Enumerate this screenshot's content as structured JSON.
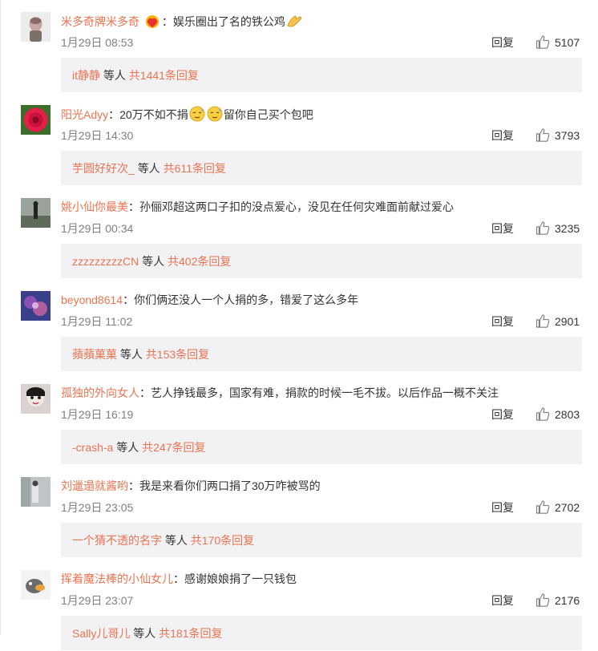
{
  "reply_label": "回复",
  "connector": "等人",
  "comments": [
    {
      "user": "米多奇牌米多奇",
      "text": "娱乐圈出了名的铁公鸡",
      "time": "1月29日 08:53",
      "likes": "5107",
      "reply_user": "it静静",
      "reply_total": "共1441条回复"
    },
    {
      "user": "阳光Adyy",
      "text_a": "20万不如不捐",
      "text_b": "留你自己买个包吧",
      "time": "1月29日 14:30",
      "likes": "3793",
      "reply_user": "芋圆好好次_",
      "reply_total": "共611条回复"
    },
    {
      "user": "姚小仙你最美",
      "text": "孙俪邓超这两口子扣的没点爱心，没见在任何灾难面前献过爱心",
      "time": "1月29日 00:34",
      "likes": "3235",
      "reply_user": "zzzzzzzzzCN",
      "reply_total": "共402条回复"
    },
    {
      "user": "beyond8614",
      "text": "你们俩还没人一个人捐的多，错爱了这么多年",
      "time": "1月29日 11:02",
      "likes": "2901",
      "reply_user": "蘋蘋菓菓",
      "reply_total": "共153条回复"
    },
    {
      "user": "孤独的外向女人",
      "text": "艺人挣钱最多，国家有难，捐款的时候一毛不拔。以后作品一概不关注",
      "time": "1月29日 16:19",
      "likes": "2803",
      "reply_user": "-crash-a",
      "reply_total": "共247条回复"
    },
    {
      "user": "刘邋遢就酱哟",
      "text": "我是来看你们两口捐了30万咋被骂的",
      "time": "1月29日 23:05",
      "likes": "2702",
      "reply_user": "一个猜不透的名字",
      "reply_total": "共170条回复"
    },
    {
      "user": "挥着魔法棒的小仙女儿",
      "text": "感谢娘娘捐了一只钱包",
      "time": "1月29日 23:07",
      "likes": "2176",
      "reply_user": "Sally儿哥儿",
      "reply_total": "共181条回复"
    }
  ]
}
